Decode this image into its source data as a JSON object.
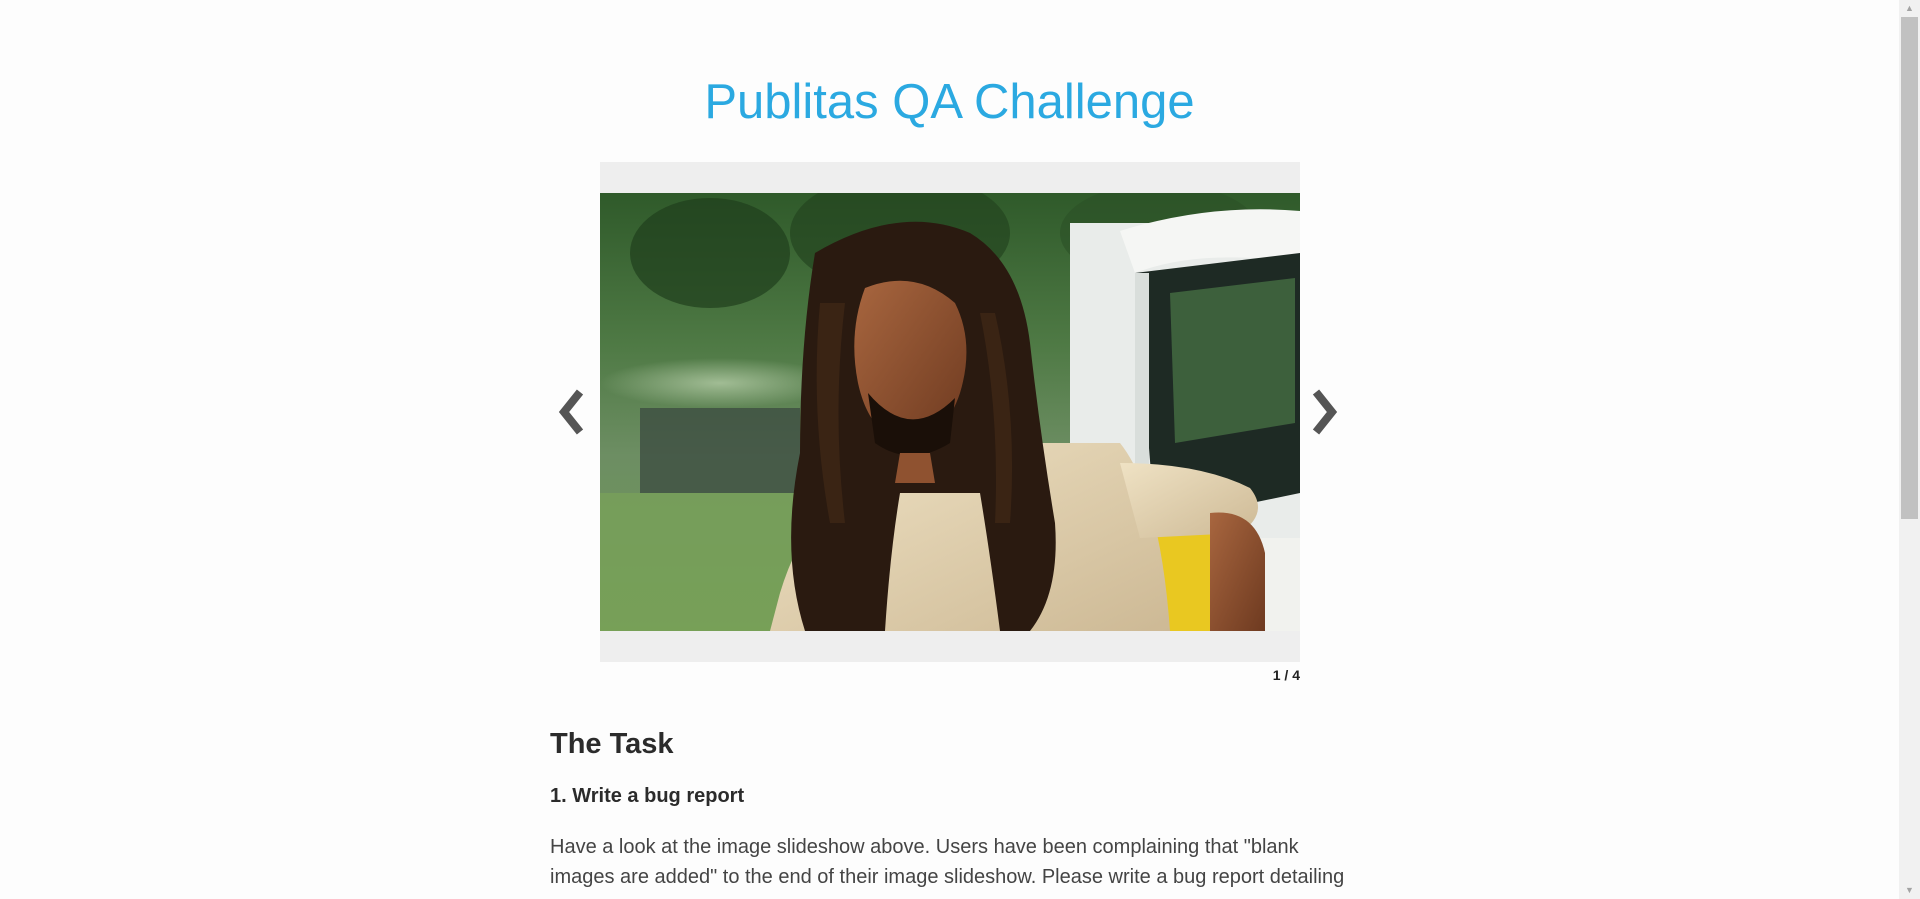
{
  "header": {
    "title": "Publitas QA Challenge"
  },
  "slideshow": {
    "current": 1,
    "total": 4,
    "counter_text": "1 / 4",
    "image": "photo-portrait-man-with-dreadlocks-beside-van",
    "prev_icon": "chevron-left-icon",
    "next_icon": "chevron-right-icon"
  },
  "content": {
    "heading": "The Task",
    "step": "1. Write a bug report",
    "paragraph": "Have a look at the image slideshow above. Users have been complaining that \"blank images are added\" to the end of their image slideshow. Please write a bug report detailing"
  },
  "colors": {
    "title": "#2ba9e1",
    "slide_bg": "#eeeeee",
    "arrow": "#555555"
  }
}
